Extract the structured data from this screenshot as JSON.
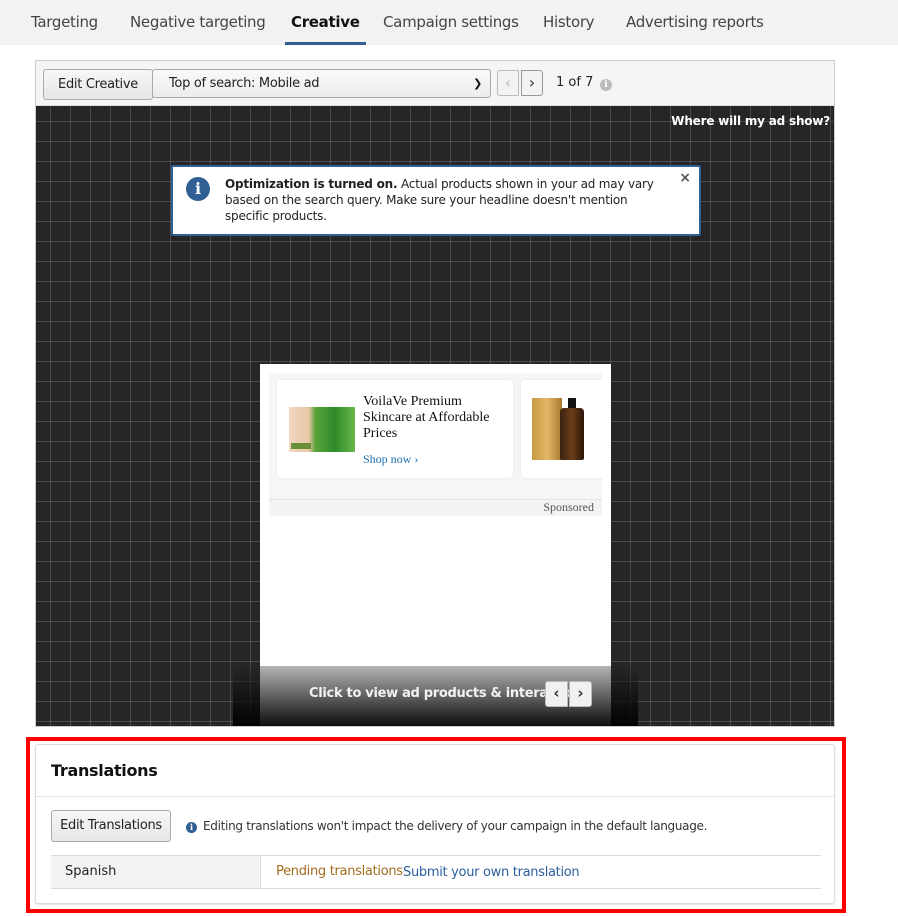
{
  "tabs": [
    {
      "label": "Targeting",
      "active": false
    },
    {
      "label": "Negative targeting",
      "active": false
    },
    {
      "label": "Creative",
      "active": true
    },
    {
      "label": "Campaign settings",
      "active": false
    },
    {
      "label": "History",
      "active": false
    },
    {
      "label": "Advertising reports",
      "active": false
    }
  ],
  "toolbar": {
    "edit_creative_label": "Edit Creative",
    "placement_select": {
      "selected": "Top of search: Mobile ad"
    },
    "prev_icon": "chevron-left-icon",
    "next_icon": "chevron-right-icon",
    "page_indicator": "1 of 7",
    "info_icon": "info-icon"
  },
  "preview": {
    "where_link": "Where will my ad show?",
    "alert": {
      "bold": "Optimization is turned on.",
      "text": " Actual products shown in your ad may vary based on the search query. Make sure your headline doesn't mention specific products.",
      "close": "×"
    },
    "ad": {
      "headline": "VoilaVe Premium Skincare at Affordable Prices",
      "cta": "Shop now ›",
      "sponsored": "Sponsored"
    },
    "overlay_text": "Click to view ad products & interaction",
    "overlay_prev": "‹",
    "overlay_next": "›"
  },
  "translations": {
    "title": "Translations",
    "edit_label": "Edit Translations",
    "note": "Editing translations won't impact the delivery of your campaign in the default language.",
    "rows": [
      {
        "language": "Spanish",
        "status": "Pending translations",
        "action": "Submit your own translation"
      }
    ]
  },
  "colors": {
    "accent": "#2f5f93",
    "pending": "#a56b1d",
    "link": "#2a5f9e",
    "highlight": "#ff0000"
  }
}
